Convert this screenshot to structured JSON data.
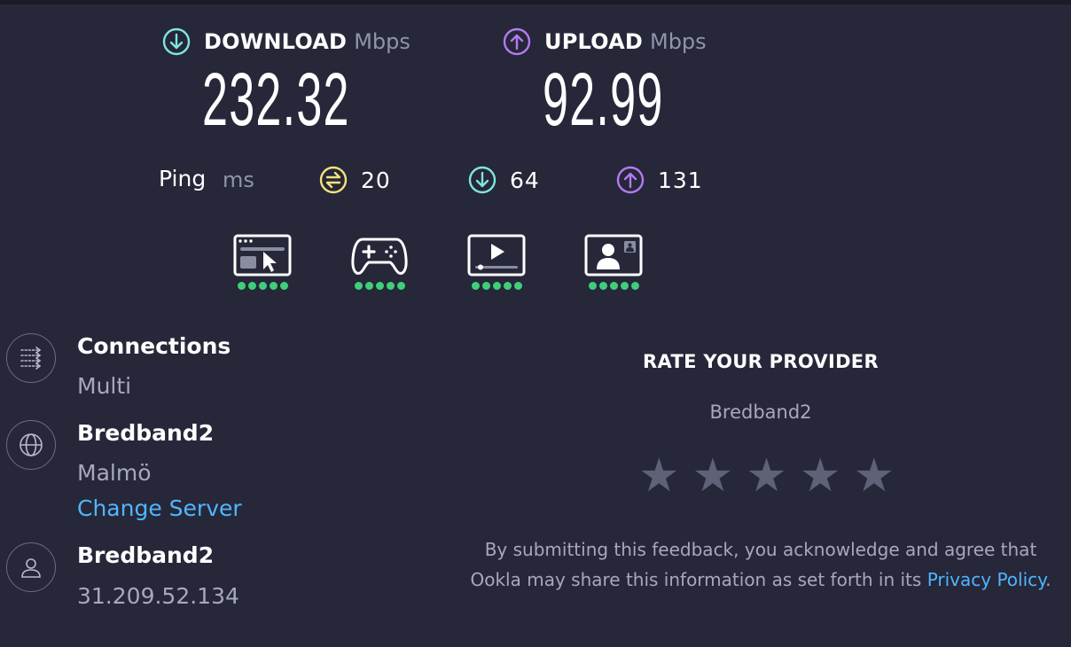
{
  "download": {
    "label": "DOWNLOAD",
    "unit": "Mbps",
    "value": "232.32"
  },
  "upload": {
    "label": "UPLOAD",
    "unit": "Mbps",
    "value": "92.99"
  },
  "ping": {
    "label": "Ping",
    "unit": "ms",
    "idle": "20",
    "download": "64",
    "upload": "131"
  },
  "usage": [
    {
      "name": "web-browsing",
      "rating": 5
    },
    {
      "name": "gaming",
      "rating": 5
    },
    {
      "name": "video-streaming",
      "rating": 5
    },
    {
      "name": "video-chat",
      "rating": 5
    }
  ],
  "info": {
    "connections": {
      "title": "Connections",
      "value": "Multi"
    },
    "server": {
      "title": "Bredband2",
      "location": "Malmö",
      "change_label": "Change Server"
    },
    "client": {
      "title": "Bredband2",
      "ip": "31.209.52.134"
    }
  },
  "rate": {
    "title": "RATE YOUR PROVIDER",
    "provider": "Bredband2",
    "stars": 5,
    "disclaimer_before": "By submitting this feedback, you acknowledge and agree that Ookla may share this information as set forth in its ",
    "policy_label": "Privacy Policy",
    "disclaimer_after": "."
  },
  "colors": {
    "background": "#262739",
    "download_accent": "#7de6e0",
    "upload_accent": "#b37bf2",
    "idle_accent": "#f3e27b",
    "good_dot": "#3fcf7a",
    "link": "#4fb6ff"
  }
}
